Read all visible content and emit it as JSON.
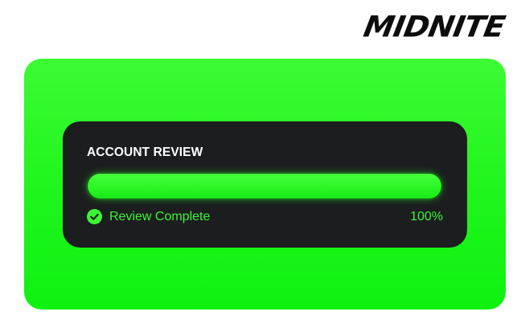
{
  "brand": {
    "logo_text": "MIDNITE"
  },
  "colors": {
    "accent_green": "#2af524",
    "card_background": "#1c1d1f",
    "status_text": "#3cf534"
  },
  "review": {
    "title": "ACCOUNT REVIEW",
    "progress_percent": 100,
    "progress_label": "100%",
    "status_text": "Review Complete",
    "status_icon": "check-circle-icon"
  }
}
